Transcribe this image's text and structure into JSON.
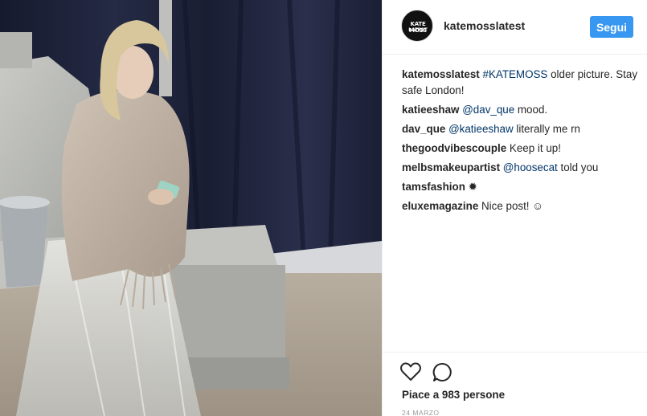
{
  "header": {
    "avatar_line1": "KATE MOSS",
    "avatar_line2": "LATEST",
    "username": "katemosslatest",
    "follow_label": "Segui"
  },
  "caption": {
    "user": "katemosslatest",
    "hashtag": "#KATEMOSS",
    "text": " older picture. Stay safe London!"
  },
  "comments": [
    {
      "user": "katieeshaw",
      "mention": "@dav_que",
      "text": " mood."
    },
    {
      "user": "dav_que",
      "mention": "@katieeshaw",
      "text": " literally me rn"
    },
    {
      "user": "thegoodvibescouple",
      "mention": "",
      "text": " Keep it up!"
    },
    {
      "user": "melbsmakeupartist",
      "mention": "@hoosecat",
      "text": " told you"
    },
    {
      "user": "tamsfashion",
      "mention": "",
      "text": " ✹"
    },
    {
      "user": "eluxemagazine",
      "mention": "",
      "text": " Nice post! ☺"
    }
  ],
  "actions": {
    "like_icon": "heart-icon",
    "comment_icon": "comment-icon",
    "likes_text": "Piace a 983 persone",
    "date": "24 MARZO"
  },
  "colors": {
    "follow_button": "#3897f0",
    "link": "#003569",
    "text": "#262626",
    "muted": "#999999"
  }
}
